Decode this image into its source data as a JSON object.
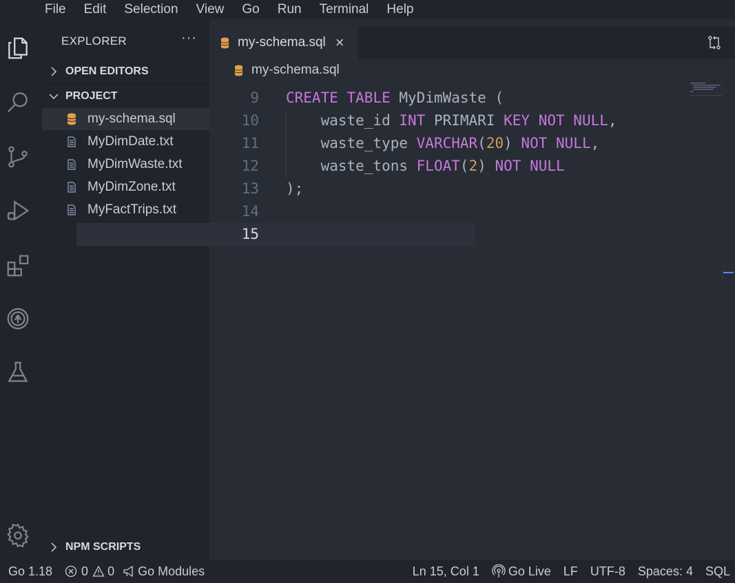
{
  "menubar": {
    "items": [
      "File",
      "Edit",
      "Selection",
      "View",
      "Go",
      "Run",
      "Terminal",
      "Help"
    ]
  },
  "sidebar": {
    "title": "EXPLORER",
    "more": "···",
    "sections": {
      "open_editors": "OPEN EDITORS",
      "project": "PROJECT",
      "npm_scripts": "NPM SCRIPTS"
    },
    "files": [
      "my-schema.sql",
      "MyDimDate.txt",
      "MyDimWaste.txt",
      "MyDimZone.txt",
      "MyFactTrips.txt"
    ]
  },
  "tab": {
    "name": "my-schema.sql",
    "close": "×"
  },
  "breadcrumb": {
    "file": "my-schema.sql"
  },
  "editor": {
    "line_numbers": [
      "9",
      "10",
      "11",
      "12",
      "13",
      "14",
      "15"
    ],
    "line9": {
      "kw1": "CREATE",
      "kw2": "TABLE",
      "rest": "MyDimWaste ("
    },
    "line10": {
      "a": "    waste_id ",
      "b": "INT",
      "c": " PRIMARI ",
      "d": "KEY",
      "e": " ",
      "f": "NOT",
      "g": " ",
      "h": "NULL",
      "i": ","
    },
    "line11": {
      "a": "    waste_type ",
      "b": "VARCHAR",
      "c": "(",
      "d": "20",
      "e": ") ",
      "f": "NOT",
      "g": " ",
      "h": "NULL",
      "i": ","
    },
    "line12": {
      "a": "    waste_tons ",
      "b": "FLOAT",
      "c": "(",
      "d": "2",
      "e": ") ",
      "f": "NOT",
      "g": " ",
      "h": "NULL"
    },
    "line13": ");"
  },
  "statusbar": {
    "go_version": "Go 1.18",
    "errors": "0",
    "warnings": "0",
    "go_modules": "Go Modules",
    "position": "Ln 15, Col 1",
    "go_live": "Go Live",
    "eol": "LF",
    "encoding": "UTF-8",
    "spaces": "Spaces: 4",
    "language": "SQL"
  },
  "colors": {
    "keyword": "#c678dd",
    "number": "#d19a66",
    "accent": "#528bff",
    "sql_icon": "#e5a04b"
  }
}
